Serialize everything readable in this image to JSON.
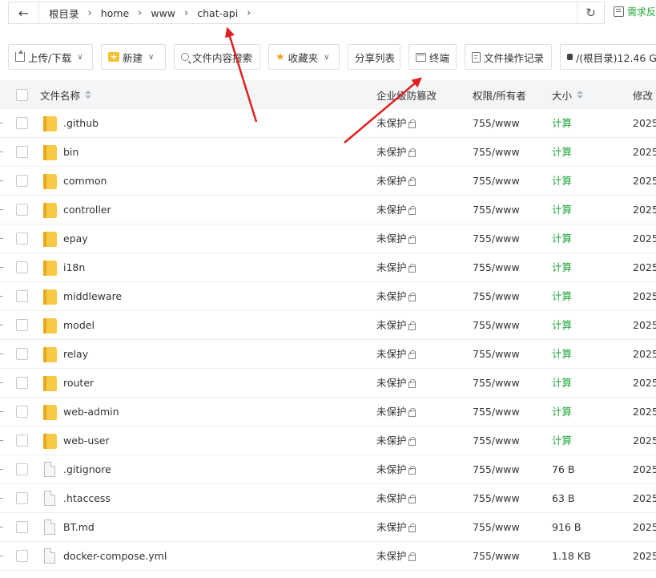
{
  "address_bar": {
    "crumbs": [
      "根目录",
      "home",
      "www",
      "chat-api"
    ]
  },
  "feedback_label": "需求反",
  "toolbar": {
    "upload_label": "上传/下载",
    "new_label": "新建",
    "search_label": "文件内容搜索",
    "favorites_label": "收藏夹",
    "share_label": "分享列表",
    "terminal_label": "终端",
    "oplog_label": "文件操作记录",
    "disk_label": "/(根目录)12.46 G"
  },
  "table": {
    "headers": {
      "name": "文件名称",
      "protection": "企业级防篡改",
      "permission": "权限/所有者",
      "size": "大小",
      "modified": "修改"
    },
    "rows": [
      {
        "type": "folder",
        "name": ".github",
        "protection": "未保护",
        "permission": "755/www",
        "size": "计算",
        "date": "2025"
      },
      {
        "type": "folder",
        "name": "bin",
        "protection": "未保护",
        "permission": "755/www",
        "size": "计算",
        "date": "2025"
      },
      {
        "type": "folder",
        "name": "common",
        "protection": "未保护",
        "permission": "755/www",
        "size": "计算",
        "date": "2025"
      },
      {
        "type": "folder",
        "name": "controller",
        "protection": "未保护",
        "permission": "755/www",
        "size": "计算",
        "date": "2025"
      },
      {
        "type": "folder",
        "name": "epay",
        "protection": "未保护",
        "permission": "755/www",
        "size": "计算",
        "date": "2025"
      },
      {
        "type": "folder",
        "name": "i18n",
        "protection": "未保护",
        "permission": "755/www",
        "size": "计算",
        "date": "2025"
      },
      {
        "type": "folder",
        "name": "middleware",
        "protection": "未保护",
        "permission": "755/www",
        "size": "计算",
        "date": "2025"
      },
      {
        "type": "folder",
        "name": "model",
        "protection": "未保护",
        "permission": "755/www",
        "size": "计算",
        "date": "2025"
      },
      {
        "type": "folder",
        "name": "relay",
        "protection": "未保护",
        "permission": "755/www",
        "size": "计算",
        "date": "2025"
      },
      {
        "type": "folder",
        "name": "router",
        "protection": "未保护",
        "permission": "755/www",
        "size": "计算",
        "date": "2025"
      },
      {
        "type": "folder",
        "name": "web-admin",
        "protection": "未保护",
        "permission": "755/www",
        "size": "计算",
        "date": "2025"
      },
      {
        "type": "folder",
        "name": "web-user",
        "protection": "未保护",
        "permission": "755/www",
        "size": "计算",
        "date": "2025"
      },
      {
        "type": "file",
        "name": ".gitignore",
        "protection": "未保护",
        "permission": "755/www",
        "size": "76 B",
        "date": "2025"
      },
      {
        "type": "file",
        "name": ".htaccess",
        "protection": "未保护",
        "permission": "755/www",
        "size": "63 B",
        "date": "2025"
      },
      {
        "type": "file",
        "name": "BT.md",
        "protection": "未保护",
        "permission": "755/www",
        "size": "916 B",
        "date": "2025"
      },
      {
        "type": "file",
        "name": "docker-compose.yml",
        "protection": "未保护",
        "permission": "755/www",
        "size": "1.18 KB",
        "date": "2025"
      }
    ]
  },
  "colors": {
    "accent_green": "#20a53a",
    "annotation_red": "#e02020"
  }
}
